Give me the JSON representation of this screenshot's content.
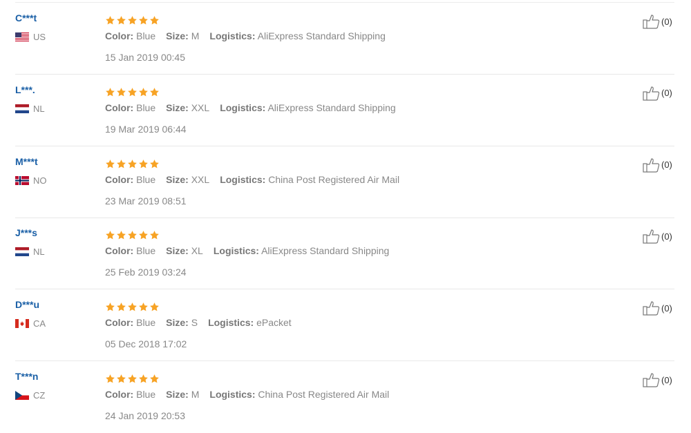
{
  "colors": {
    "username": "#1a5fa6",
    "star": "#f7a325",
    "text": "#888888"
  },
  "labels": {
    "color": "Color:",
    "size": "Size:",
    "logistics": "Logistics:"
  },
  "reviews": [
    {
      "user": "C***t",
      "country": "US",
      "flag": "us",
      "rating": 5,
      "color": "Blue",
      "size": "M",
      "logistics": "AliExpress Standard Shipping",
      "date": "15 Jan 2019 00:45",
      "helpful": "(0)"
    },
    {
      "user": "L***.",
      "country": "NL",
      "flag": "nl",
      "rating": 5,
      "color": "Blue",
      "size": "XXL",
      "logistics": "AliExpress Standard Shipping",
      "date": "19 Mar 2019 06:44",
      "helpful": "(0)"
    },
    {
      "user": "M***t",
      "country": "NO",
      "flag": "no",
      "rating": 5,
      "color": "Blue",
      "size": "XXL",
      "logistics": "China Post Registered Air Mail",
      "date": "23 Mar 2019 08:51",
      "helpful": "(0)"
    },
    {
      "user": "J***s",
      "country": "NL",
      "flag": "nl",
      "rating": 5,
      "color": "Blue",
      "size": "XL",
      "logistics": "AliExpress Standard Shipping",
      "date": "25 Feb 2019 03:24",
      "helpful": "(0)"
    },
    {
      "user": "D***u",
      "country": "CA",
      "flag": "ca",
      "rating": 5,
      "color": "Blue",
      "size": "S",
      "logistics": "ePacket",
      "date": "05 Dec 2018 17:02",
      "helpful": "(0)"
    },
    {
      "user": "T***n",
      "country": "CZ",
      "flag": "cz",
      "rating": 5,
      "color": "Blue",
      "size": "M",
      "logistics": "China Post Registered Air Mail",
      "date": "24 Jan 2019 20:53",
      "helpful": "(0)"
    }
  ]
}
